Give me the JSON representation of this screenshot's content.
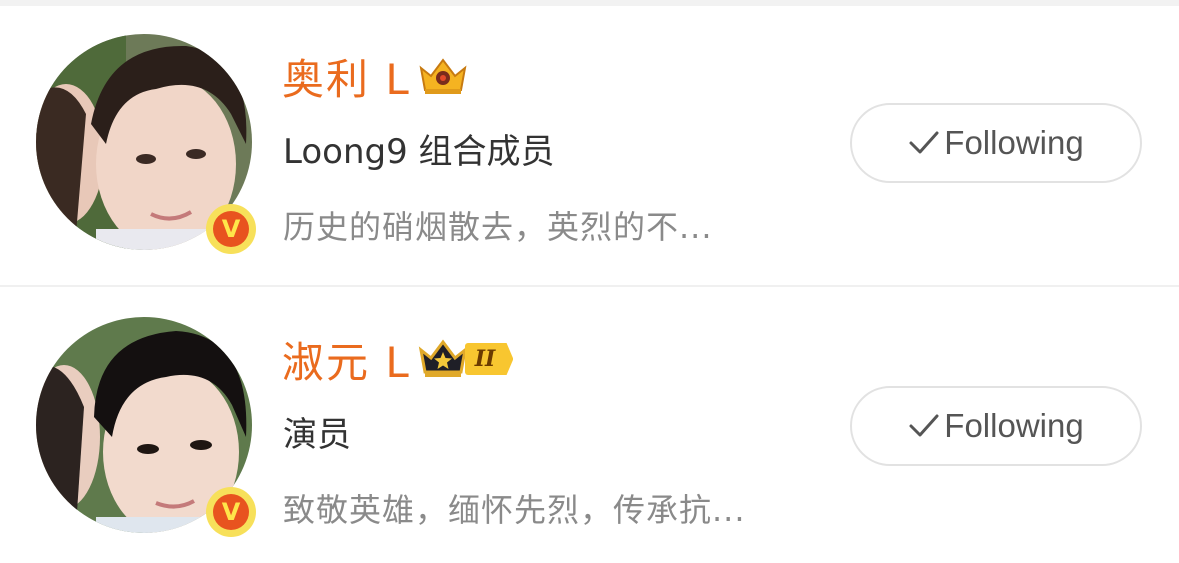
{
  "users": [
    {
      "name": "奥利 L",
      "description": "Loong9 组合成员",
      "bio": "历史的硝烟散去，英烈的不...",
      "verified_badge": "V",
      "crown_icon": "gold-crown-icon",
      "follow_label": "Following",
      "follow_icon": "checkmark-icon"
    },
    {
      "name": "淑元 L",
      "description": "演员",
      "bio": "致敬英雄，缅怀先烈，传承抗...",
      "verified_badge": "V",
      "crown_icon": "dark-star-crown-icon",
      "level_tag": "II",
      "follow_label": "Following",
      "follow_icon": "checkmark-icon"
    }
  ],
  "colors": {
    "name": "#ea6b1e",
    "description": "#333333",
    "bio": "#8a8a8a",
    "follow_text": "#555555",
    "follow_border": "#e2e2e2",
    "badge_outer": "#f7e05a",
    "badge_inner": "#e8531f",
    "level_tag": "#f8c630"
  }
}
